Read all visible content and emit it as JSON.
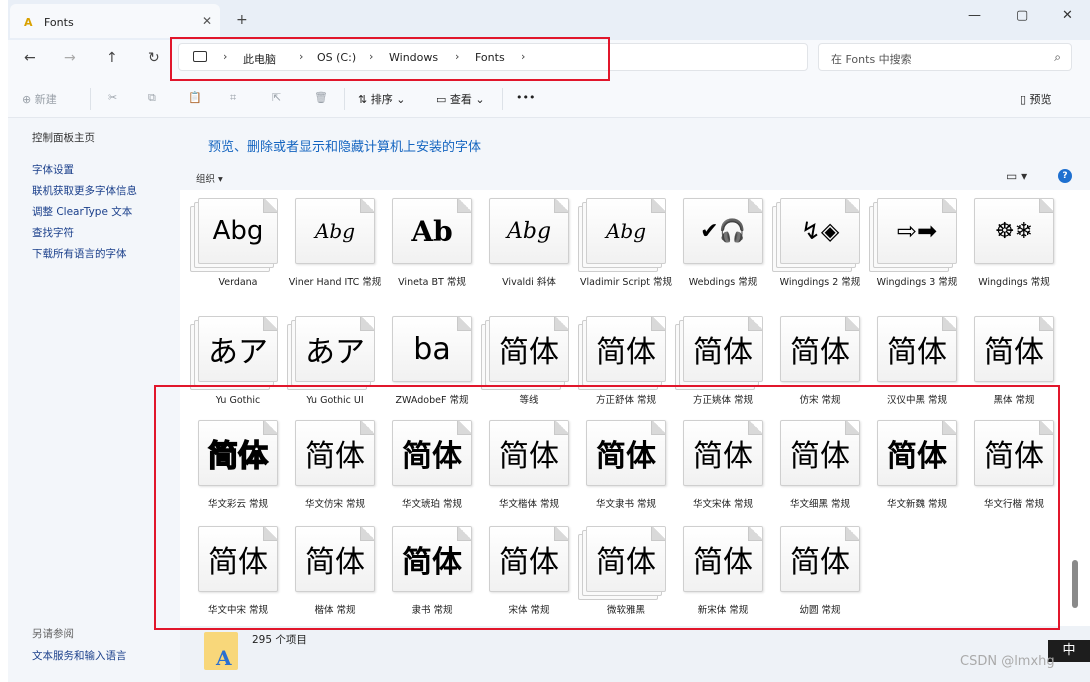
{
  "tab": {
    "title": "Fonts",
    "close": "✕",
    "new": "+"
  },
  "window_controls": {
    "minimize": "—",
    "maximize": "▢",
    "close": "✕"
  },
  "nav": {
    "back": "←",
    "forward": "→",
    "up": "↑",
    "refresh": "↻"
  },
  "breadcrumb": {
    "items": [
      "此电脑",
      "OS (C:)",
      "Windows",
      "Fonts"
    ],
    "sep": "›"
  },
  "search": {
    "placeholder": "在 Fonts 中搜索",
    "icon": "⌕"
  },
  "toolbar": {
    "new_label": "⊕ 新建",
    "cut_icon": "✂",
    "copy_icon": "⧉",
    "paste_icon": "📋",
    "rename_icon": "⌗",
    "share_icon": "⇱",
    "delete_icon": "🗑",
    "sort_label": "⇅ 排序 ⌄",
    "view_label": "▭ 查看 ⌄",
    "more_label": "•••",
    "preview_label": "▯ 预览"
  },
  "sidebar": {
    "title": "控制面板主页",
    "links": [
      "字体设置",
      "联机获取更多字体信息",
      "调整 ClearType 文本",
      "查找字符",
      "下载所有语言的字体"
    ],
    "see_also": "另请参阅",
    "bottom_link": "文本服务和输入语言"
  },
  "main": {
    "title": "预览、删除或者显示和隐藏计算机上安装的字体",
    "filter_label": "组织 ▾",
    "view_icon": "▭ ▾",
    "help_icon": "?"
  },
  "fonts": [
    {
      "sample": "Abg",
      "name": "Verdana"
    },
    {
      "sample": "Abg",
      "name": "Viner Hand ITC 常规"
    },
    {
      "sample": "Ab",
      "name": "Vineta BT 常规"
    },
    {
      "sample": "Abg",
      "name": "Vivaldi 斜体"
    },
    {
      "sample": "Abg",
      "name": "Vladimir Script 常规"
    },
    {
      "sample": "✔🎧",
      "name": "Webdings 常规"
    },
    {
      "sample": "↯◈",
      "name": "Wingdings 2 常规"
    },
    {
      "sample": "⇨➡",
      "name": "Wingdings 3 常规"
    },
    {
      "sample": "☸❄",
      "name": "Wingdings 常规"
    },
    {
      "sample": "あア",
      "name": "Yu Gothic"
    },
    {
      "sample": "あア",
      "name": "Yu Gothic UI"
    },
    {
      "sample": "ba",
      "name": "ZWAdobeF 常规"
    },
    {
      "sample": "简体",
      "name": "等线"
    },
    {
      "sample": "简体",
      "name": "方正舒体 常规"
    },
    {
      "sample": "简体",
      "name": "方正姚体 常规"
    },
    {
      "sample": "简体",
      "name": "仿宋 常规"
    },
    {
      "sample": "简体",
      "name": "汉仪中黑 常规"
    },
    {
      "sample": "简体",
      "name": "黑体 常规"
    },
    {
      "sample": "简体",
      "name": "华文彩云 常规"
    },
    {
      "sample": "简体",
      "name": "华文仿宋 常规"
    },
    {
      "sample": "简体",
      "name": "华文琥珀 常规"
    },
    {
      "sample": "简体",
      "name": "华文楷体 常规"
    },
    {
      "sample": "简体",
      "name": "华文隶书 常规"
    },
    {
      "sample": "简体",
      "name": "华文宋体 常规"
    },
    {
      "sample": "简体",
      "name": "华文细黑 常规"
    },
    {
      "sample": "简体",
      "name": "华文新魏 常规"
    },
    {
      "sample": "简体",
      "name": "华文行楷 常规"
    },
    {
      "sample": "简体",
      "name": "华文中宋 常规"
    },
    {
      "sample": "简体",
      "name": "楷体 常规"
    },
    {
      "sample": "简体",
      "name": "隶书 常规"
    },
    {
      "sample": "简体",
      "name": "宋体 常规"
    },
    {
      "sample": "简体",
      "name": "微软雅黑"
    },
    {
      "sample": "简体",
      "name": "新宋体 常规"
    },
    {
      "sample": "简体",
      "name": "幼圆 常规"
    }
  ],
  "status": {
    "count": "295 个项目",
    "icon_letter": "A"
  },
  "ime": {
    "label": "中"
  },
  "watermark": {
    "text": "CSDN @lmxhg"
  }
}
